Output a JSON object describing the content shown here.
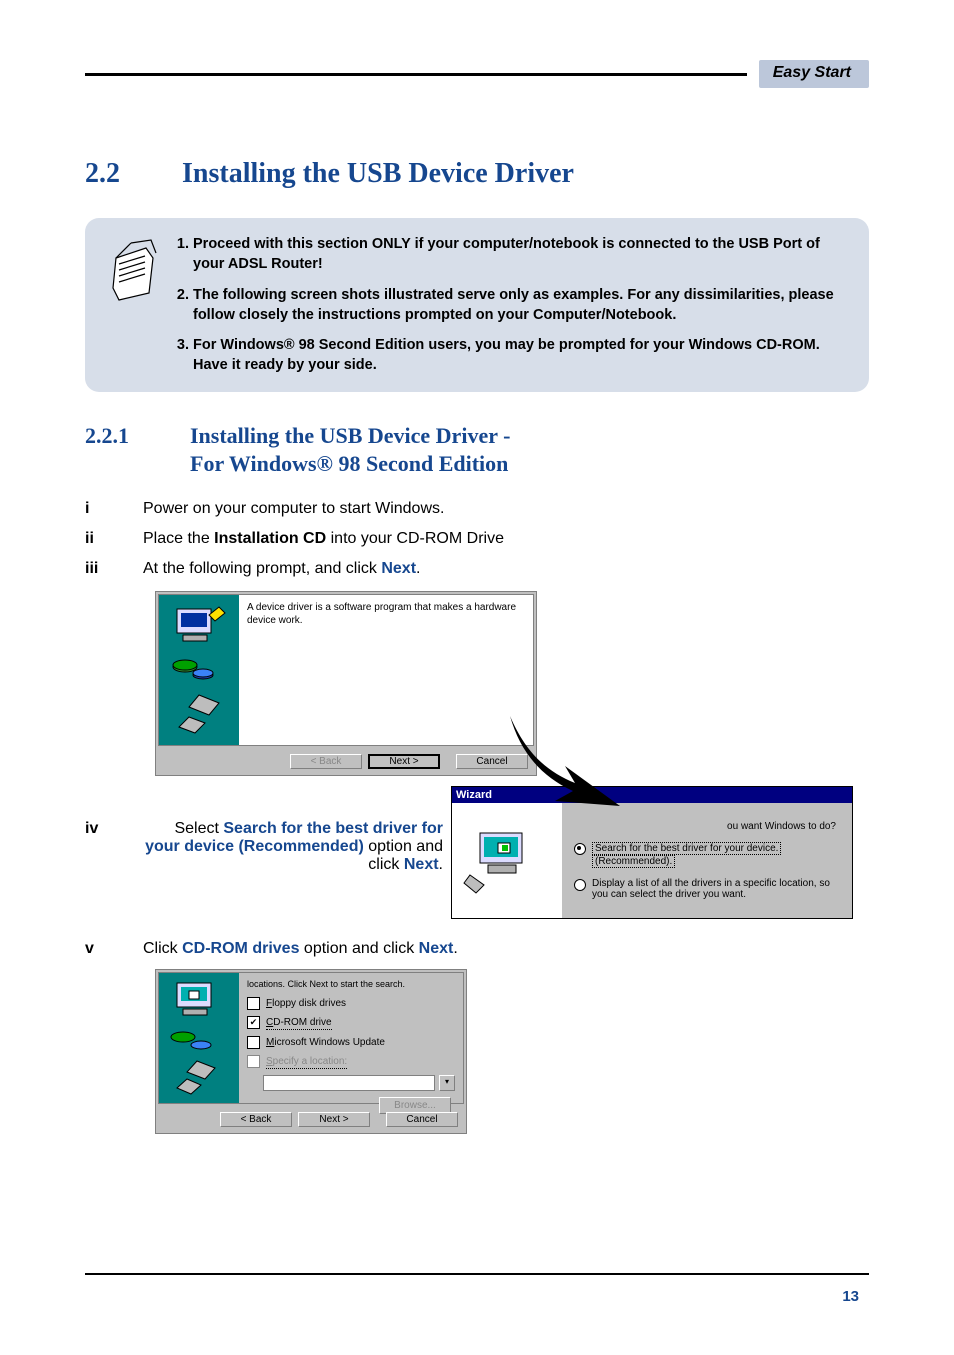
{
  "header": {
    "chip": "Easy Start"
  },
  "section": {
    "number": "2.2",
    "title": "Installing the USB Device Driver"
  },
  "callout": {
    "items": [
      "Proceed with this section ONLY if your computer/notebook is connected to the USB Port of your ADSL Router!",
      "The following screen shots illustrated serve only as examples.  For any dissimilarities, please follow closely the instructions prompted on your Computer/Notebook.",
      "For Windows® 98 Second Edition users, you may be prompted for your Windows CD-ROM.  Have it ready by your side."
    ]
  },
  "subsection": {
    "number": "2.2.1",
    "title_line1": "Installing the USB Device Driver -",
    "title_line2": "For Windows® 98 Second Edition"
  },
  "steps": {
    "i": {
      "marker": "i",
      "text": "Power on your computer to start Windows."
    },
    "ii": {
      "marker": "ii",
      "pre": "Place the ",
      "bold": "Installation CD",
      "post": " into your CD-ROM Drive"
    },
    "iii": {
      "marker": "iii",
      "pre": "At the following prompt, and click ",
      "hl": "Next",
      "post": "."
    },
    "iv": {
      "marker": "iv",
      "pre": "Select ",
      "hl1": "Search for the best driver for your device (Recommended)",
      "mid": " option and click ",
      "hl2": "Next",
      "post": "."
    },
    "v": {
      "marker": "v",
      "pre": "Click ",
      "hl1": "CD-ROM drives",
      "mid": " option and click ",
      "hl2": "Next",
      "post": "."
    }
  },
  "wizard1": {
    "intro": "A device driver is a software program that makes a hardware device work.",
    "buttons": {
      "back": "< Back",
      "next": "Next >",
      "cancel": "Cancel"
    }
  },
  "wizard2": {
    "titlebar": "Wizard",
    "prompt_tail": "ou want Windows to do?",
    "opt1a": "Search for the best driver for your device.",
    "opt1b": "(Recommended).",
    "opt2": "Display a list of all the drivers in a specific location, so you can select the driver you want."
  },
  "wizard3": {
    "top_text": "locations. Click Next to start the search.",
    "chk_floppy": "Floppy disk drives",
    "chk_cdrom": "CD-ROM drive",
    "chk_msupdate": "Microsoft Windows Update",
    "chk_specify": "Specify a location:",
    "browse": "Browse...",
    "buttons": {
      "back": "< Back",
      "next": "Next >",
      "cancel": "Cancel"
    }
  },
  "page_number": "13"
}
